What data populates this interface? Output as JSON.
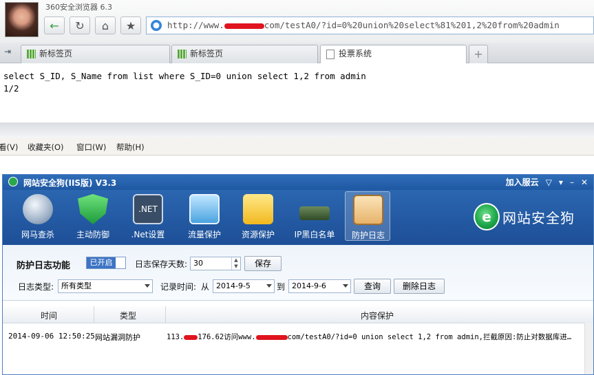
{
  "browser": {
    "name": "360安全浏览器 6.3",
    "address": {
      "prefix": "http://www.",
      "suffix": "com/testA0/?id=0%20union%20select%81%201,2%20from%20admin"
    },
    "tabs": [
      {
        "label": "新标签页"
      },
      {
        "label": "新标签页"
      },
      {
        "label": "投票系统"
      }
    ],
    "page_lines": [
      "select S_ID, S_Name from list where S_ID=0 union select 1,2 from admin",
      "1/2"
    ]
  },
  "menubar": {
    "items": [
      "看(V)",
      "收藏夹(O)",
      "窗口(W)",
      "帮助(H)"
    ]
  },
  "app": {
    "title": "网站安全狗(IIS版) V3.3",
    "join_cloud": "加入服云",
    "toolbar": [
      {
        "label": "网马查杀",
        "icon": "scan-icon"
      },
      {
        "label": "主动防御",
        "icon": "shield-icon"
      },
      {
        "label": ".Net设置",
        "icon": "net-icon"
      },
      {
        "label": "流量保护",
        "icon": "traffic-icon"
      },
      {
        "label": "资源保护",
        "icon": "folder-icon"
      },
      {
        "label": "IP黑白名单",
        "icon": "router-icon"
      },
      {
        "label": "防护日志",
        "icon": "clipboard-icon"
      }
    ],
    "brand": {
      "badge": "e",
      "text": "网站安全狗"
    },
    "settings": {
      "title": "防护日志功能",
      "status": "已开启",
      "save_days_label": "日志保存天数:",
      "save_days_value": "30",
      "save_button": "保存",
      "log_type_label": "日志类型:",
      "log_type_value": "所有类型",
      "record_time_label": "记录时间:",
      "from_label": "从",
      "from_date": "2014-9-5",
      "to_label": "到",
      "to_date": "2014-9-6",
      "query_button": "查询",
      "delete_button": "删除日志"
    },
    "table": {
      "headers": [
        "时间",
        "类型",
        "内容保护"
      ],
      "rows": [
        {
          "time": "2014-09-06 12:50:25",
          "type": "网站漏洞防护",
          "ip_prefix": "113.",
          "ip_suffix": "176.62访问www.",
          "content_tail": "com/testA0/?id=0 union select 1,2 from admin,拦截原因:防止对数据库进…"
        }
      ]
    }
  }
}
